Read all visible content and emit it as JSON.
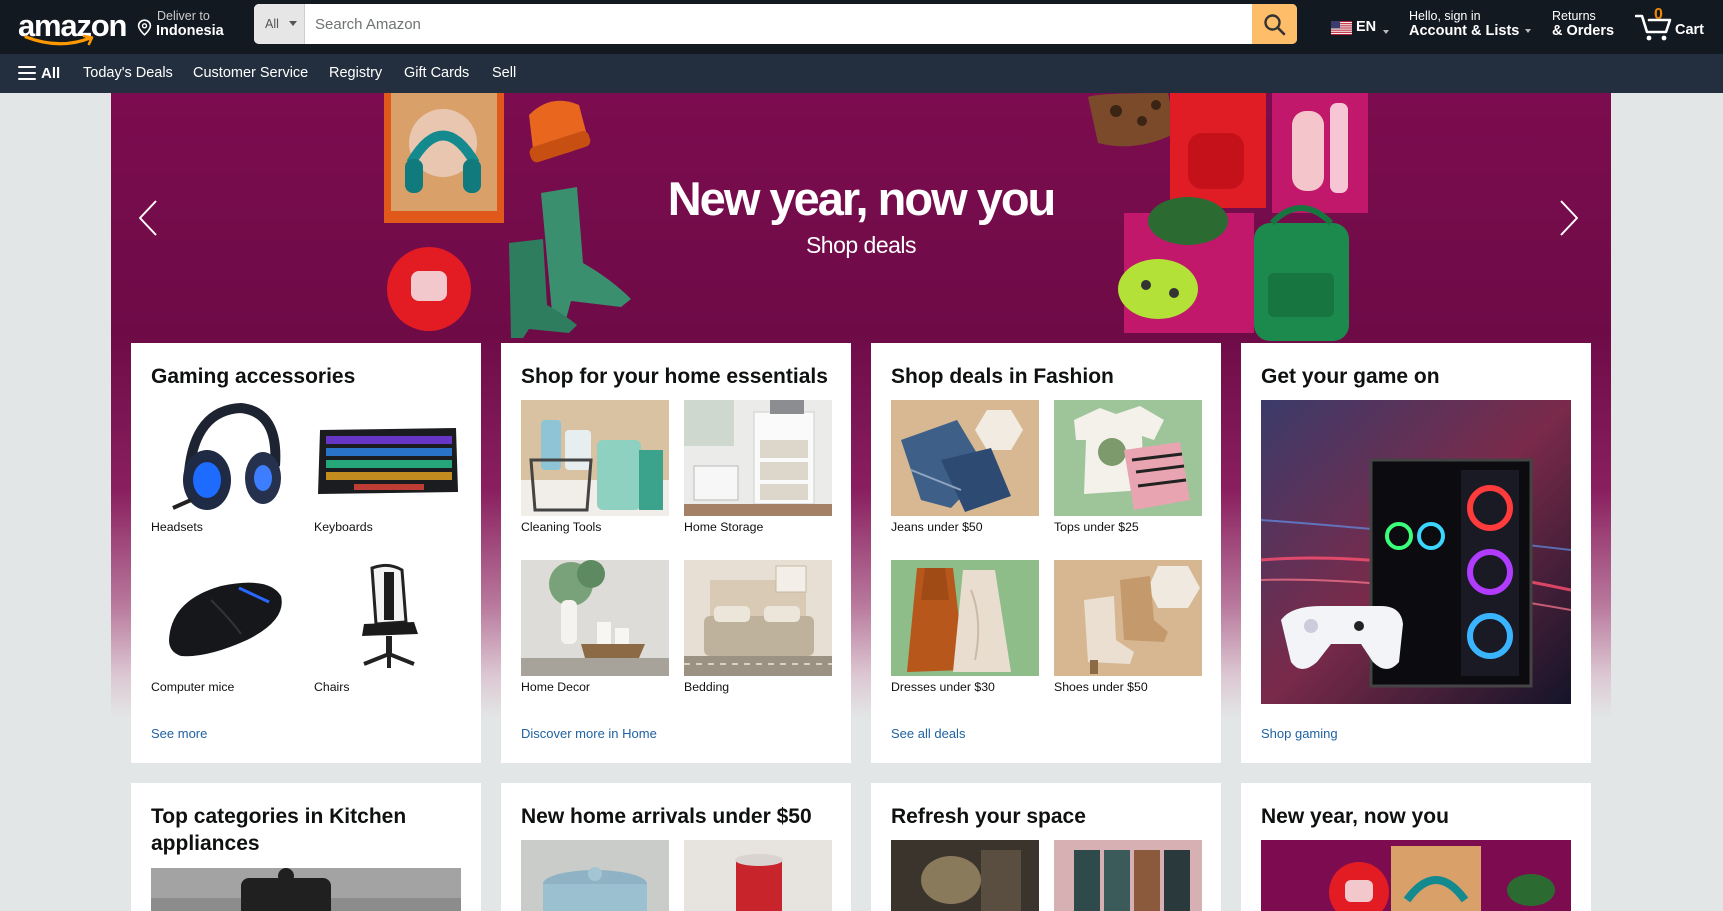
{
  "header": {
    "logo_text": "amazon",
    "deliver_label": "Deliver to",
    "deliver_location": "Indonesia",
    "search_category": "All",
    "search_placeholder": "Search Amazon",
    "language": "EN",
    "account_greeting": "Hello, sign in",
    "account_label": "Account & Lists",
    "returns_label": "Returns",
    "orders_label": "& Orders",
    "cart_count": "0",
    "cart_label": "Cart",
    "colors": {
      "nav": "#131921",
      "subnav": "#232f3e",
      "search_button": "#febd69",
      "cart_count": "#f08804"
    }
  },
  "subnav": {
    "all_label": "All",
    "links": [
      "Today's Deals",
      "Customer Service",
      "Registry",
      "Gift Cards",
      "Sell"
    ]
  },
  "hero": {
    "title": "New year, now you",
    "subtitle": "Shop deals",
    "prev_icon": "chevron-left-icon",
    "next_icon": "chevron-right-icon"
  },
  "cards_row1": [
    {
      "title": "Gaming accessories",
      "tiles": [
        "Headsets",
        "Keyboards",
        "Computer mice",
        "Chairs"
      ],
      "link": "See more"
    },
    {
      "title": "Shop for your home essentials",
      "tiles": [
        "Cleaning Tools",
        "Home Storage",
        "Home Decor",
        "Bedding"
      ],
      "link": "Discover more in Home"
    },
    {
      "title": "Shop deals in Fashion",
      "tiles": [
        "Jeans under $50",
        "Tops under $25",
        "Dresses under $30",
        "Shoes under $50"
      ],
      "link": "See all deals"
    },
    {
      "title": "Get your game on",
      "link": "Shop gaming"
    }
  ],
  "cards_row2": [
    {
      "title": "Top categories in Kitchen appliances"
    },
    {
      "title": "New home arrivals under $50"
    },
    {
      "title": "Refresh your space"
    },
    {
      "title": "New year, now you"
    }
  ]
}
